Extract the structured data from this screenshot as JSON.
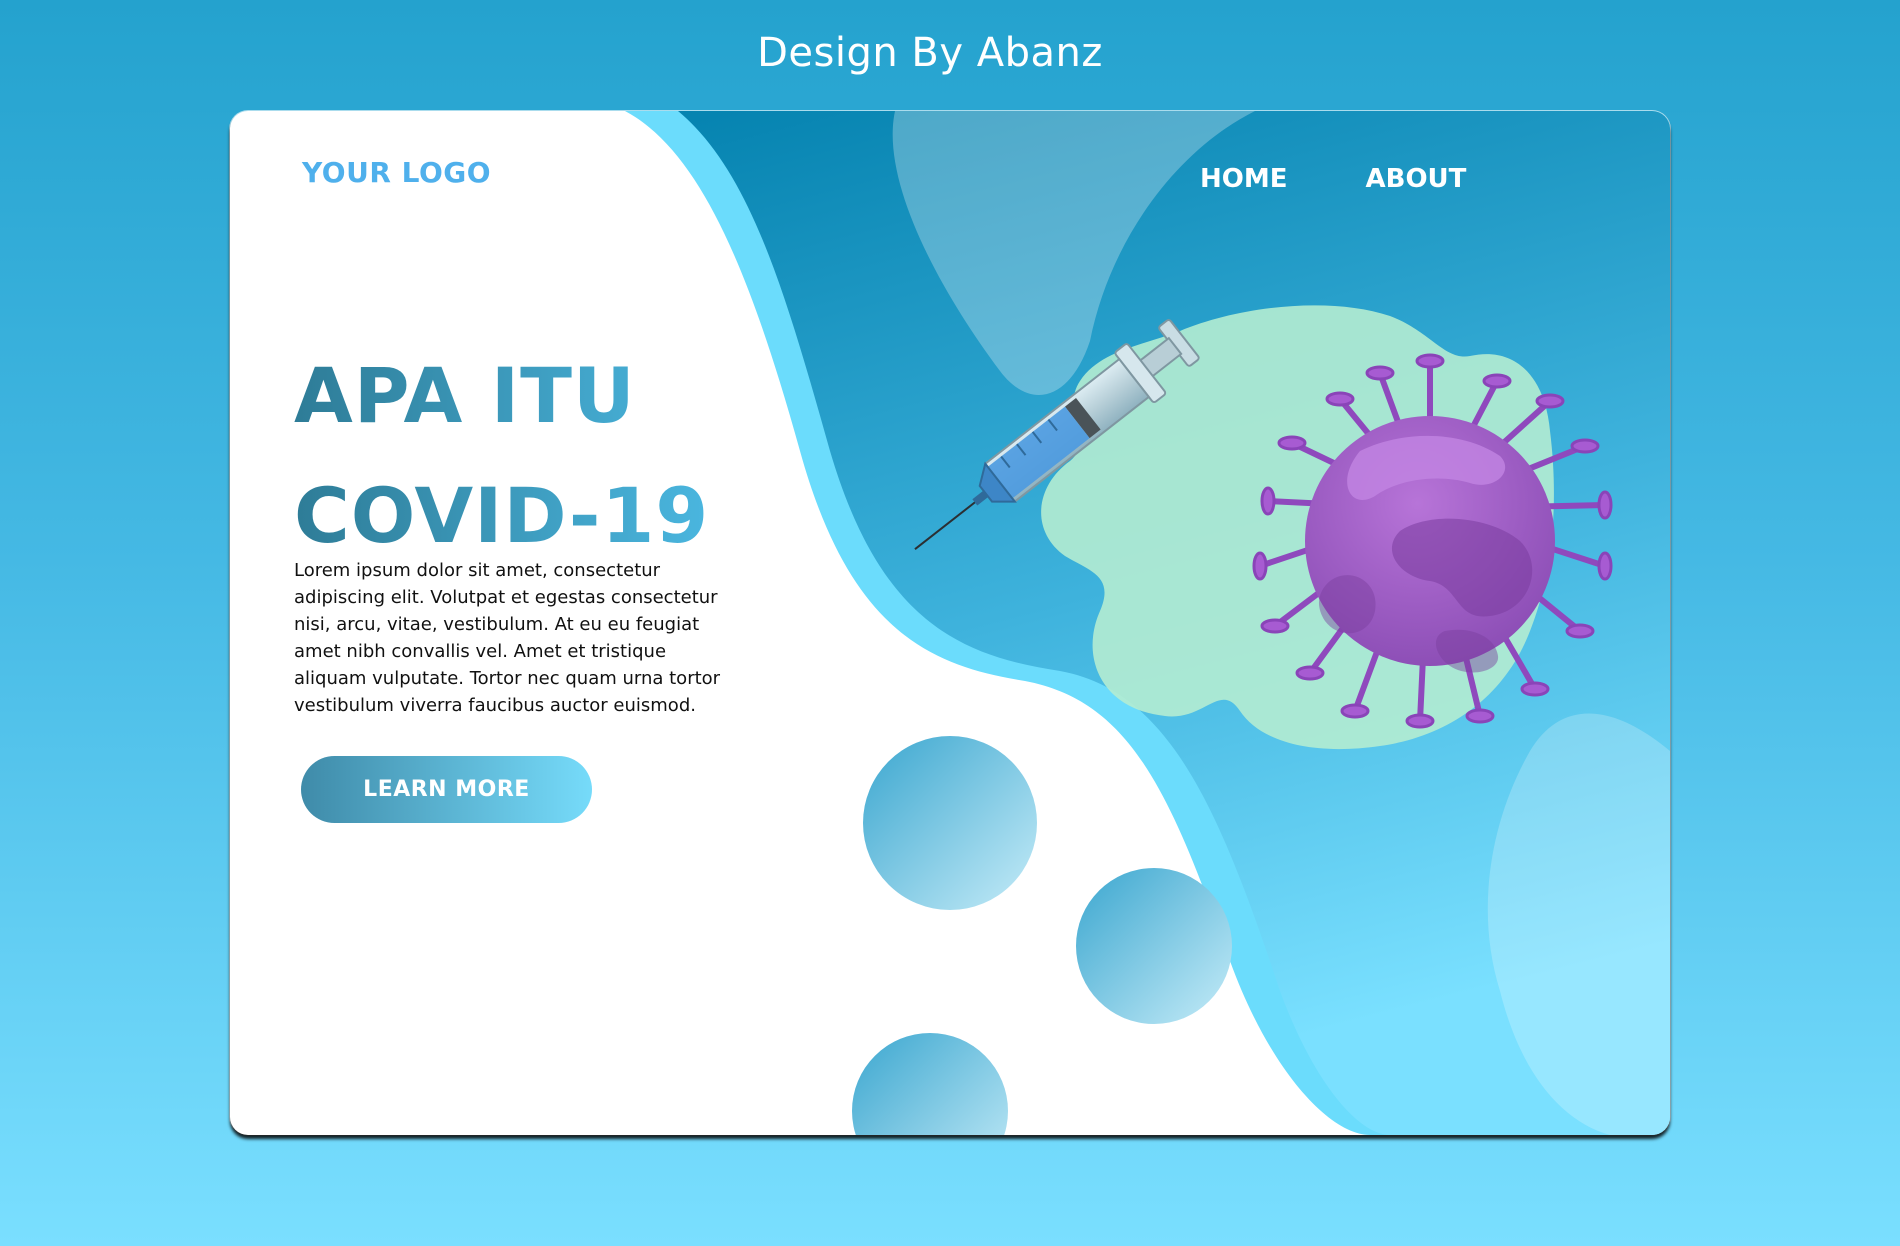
{
  "credit": "Design By Abanz",
  "header": {
    "logo": "YOUR LOGO",
    "nav": [
      "HOME",
      "ABOUT"
    ]
  },
  "hero": {
    "title_line1": "APA ITU",
    "title_line2": "COVID-19",
    "body": "Lorem ipsum dolor sit amet, consectetur adipiscing elit. Volutpat et egestas consectetur nisi, arcu, vitae, vestibulum. At eu eu feugiat amet nibh convallis vel. Amet et tristique aliquam vulputate. Tortor nec quam urna tortor vestibulum viverra faucibus auctor euismod.",
    "cta": "LEARN MORE"
  },
  "illustration": {
    "icons": [
      "syringe-icon",
      "virus-icon"
    ]
  },
  "colors": {
    "accent": "#4fb0ec",
    "panel_dark": "#0583b0",
    "panel_light": "#6bdcfc",
    "virus": "#9c5bc6",
    "blob": "#b4ecd2"
  }
}
